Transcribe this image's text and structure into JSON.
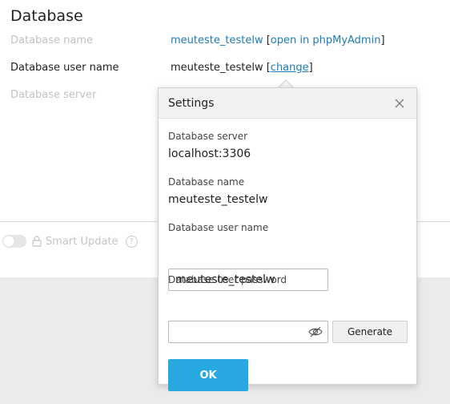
{
  "section": {
    "title": "Database"
  },
  "rows": {
    "db_name_label": "Database name",
    "db_name_value": "meuteste_testelw",
    "db_name_link": "open in phpMyAdmin",
    "db_user_label": "Database user name",
    "db_user_value": "meuteste_testelw",
    "db_user_link": "change",
    "db_server_label": "Database server"
  },
  "smart_update": {
    "label": "Smart Update",
    "help": "?",
    "enabled": false
  },
  "popover": {
    "title": "Settings",
    "server_label": "Database server",
    "server_value": "localhost:3306",
    "name_label": "Database name",
    "name_value": "meuteste_testelw",
    "user_label": "Database user name",
    "user_input_value": "meuteste_testelw",
    "password_label": "Database user password",
    "password_value": "",
    "generate_label": "Generate",
    "ok_label": "OK"
  },
  "colors": {
    "link": "#1f7cb5",
    "primary_button": "#28a8e0",
    "muted_text": "#c2c2c2"
  },
  "icons": {
    "close": "close-icon",
    "eye": "eye-off-icon",
    "lock": "lock-icon",
    "help": "help-icon"
  }
}
